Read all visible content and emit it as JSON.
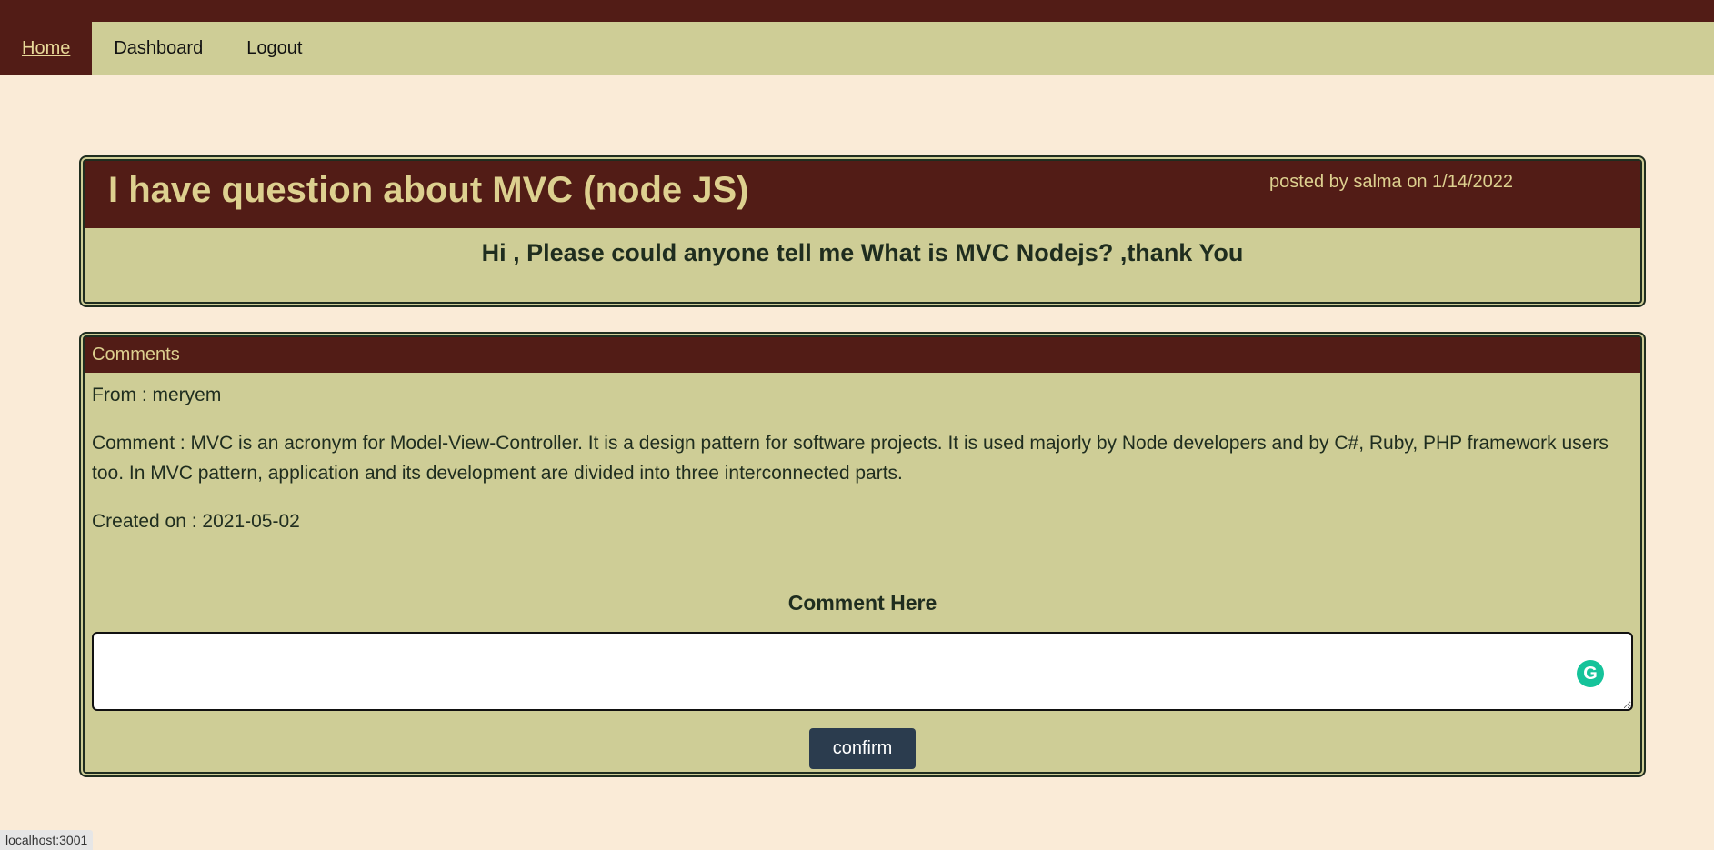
{
  "nav": {
    "home": "Home",
    "dashboard": "Dashboard",
    "logout": "Logout"
  },
  "post": {
    "title": "I have question about MVC (node JS)",
    "meta": "posted by salma on 1/14/2022",
    "body": "Hi , Please could anyone tell me What is MVC Nodejs? ,thank You"
  },
  "comments": {
    "header": "Comments",
    "items": [
      {
        "from": "From : meryem",
        "text": "Comment : MVC is an acronym for Model-View-Controller. It is a design pattern for software projects. It is used majorly by Node developers and by C#, Ruby, PHP framework users too. In MVC pattern, application and its development are divided into three interconnected parts.",
        "created": "Created on : 2021-05-02"
      }
    ]
  },
  "form": {
    "label": "Comment Here",
    "textarea_value": "",
    "confirm_label": "confirm"
  },
  "status_bar": {
    "url": "localhost:3001"
  },
  "colors": {
    "page_bg": "#faebd7",
    "nav_bg": "#cecd96",
    "header_bg": "#521c16",
    "header_text": "#ddd08f",
    "button_bg": "#2b3c4e"
  },
  "icons": {
    "grammarly": "grammarly-icon"
  }
}
